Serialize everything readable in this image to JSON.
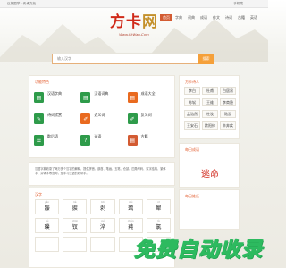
{
  "topbar": {
    "links": "弘扬国学 · 传承文化",
    "mobile": "手机端"
  },
  "logo": {
    "main": "方卡",
    "accent": "网",
    "url": "Www.FkWan.Com"
  },
  "nav": [
    "首页",
    "字典",
    "词典",
    "成语",
    "作文",
    "诗词",
    "古籍",
    "英语"
  ],
  "search": {
    "placeholder": "输入汉字",
    "button": "搜索"
  },
  "features": {
    "title": "功能特色",
    "items": [
      {
        "label": "汉语字典",
        "sub": "",
        "icon": "book-icon",
        "color": "#2e9b4a"
      },
      {
        "label": "汉语词典",
        "sub": "",
        "icon": "book-icon",
        "color": "#2e9b4a"
      },
      {
        "label": "成语大全",
        "sub": "",
        "icon": "book-icon",
        "color": "#e96a1f"
      },
      {
        "label": "诗词欣赏",
        "sub": "",
        "icon": "scroll-icon",
        "color": "#2e9b4a"
      },
      {
        "label": "近义词",
        "sub": "",
        "icon": "pen-icon",
        "color": "#e96a1f"
      },
      {
        "label": "反义词",
        "sub": "",
        "icon": "pen-icon",
        "color": "#2e9b4a"
      },
      {
        "label": "歇后语",
        "sub": "",
        "icon": "chat-icon",
        "color": "#2e9b4a"
      },
      {
        "label": "谜语",
        "sub": "",
        "icon": "puzzle-icon",
        "color": "#2e9b4a"
      },
      {
        "label": "古籍",
        "sub": "",
        "icon": "book-icon",
        "color": "#d35b32"
      }
    ]
  },
  "radicals": {
    "title": "方卡诗人",
    "items": [
      "李白",
      "杜甫",
      "白居易",
      "苏轼",
      "王维",
      "李商隐",
      "孟浩然",
      "杜牧",
      "陆游",
      "王安石",
      "欧阳修",
      "辛弃疾"
    ]
  },
  "idiom": {
    "title": "每日成语",
    "text": "逃命"
  },
  "surname": {
    "title": "每日姓氏"
  },
  "intro": {
    "text": "汉语字典收录了两万多个汉字的解释，提供拼音、部首、笔画、五笔、仓颉、四角号码、汉字结构、繁体字、异体字等查询，是学习汉语的好帮手。"
  },
  "chars": {
    "title": "汉字",
    "items": [
      {
        "py": "yǎn",
        "ch": "鼹"
      },
      {
        "py": "liè",
        "ch": "捩"
      },
      {
        "py": "bō",
        "ch": "剥"
      },
      {
        "py": "qiú",
        "ch": "巯"
      },
      {
        "py": "xī",
        "ch": "犀"
      },
      {
        "py": "pú",
        "ch": "璞"
      },
      {
        "py": "chāi",
        "ch": "钗"
      },
      {
        "py": "cuì",
        "ch": "淬"
      },
      {
        "py": "chún",
        "ch": "莼"
      },
      {
        "py": "lǜ",
        "ch": "氯"
      },
      {
        "py": "",
        "ch": ""
      },
      {
        "py": "",
        "ch": ""
      },
      {
        "py": "",
        "ch": ""
      },
      {
        "py": "",
        "ch": ""
      },
      {
        "py": "",
        "ch": ""
      }
    ]
  },
  "watermark": "免费自动收录"
}
